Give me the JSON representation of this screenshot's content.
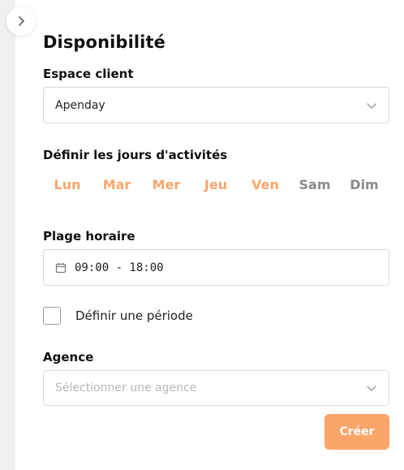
{
  "colors": {
    "accent": "#fba56b",
    "inactive_day": "#8a8a8a",
    "border": "#d9d9d9"
  },
  "header": {
    "collapse_icon": "chevron-right-icon",
    "title": "Disponibilité"
  },
  "client_space": {
    "label": "Espace client",
    "value": "Apenday",
    "icon": "chevron-down-icon"
  },
  "activity_days": {
    "label": "Définir les jours d'activités",
    "days": [
      {
        "label": "Lun",
        "active": true
      },
      {
        "label": "Mar",
        "active": true
      },
      {
        "label": "Mer",
        "active": true
      },
      {
        "label": "Jeu",
        "active": true
      },
      {
        "label": "Ven",
        "active": true
      },
      {
        "label": "Sam",
        "active": false
      },
      {
        "label": "Dim",
        "active": false
      }
    ]
  },
  "time_range": {
    "label": "Plage horaire",
    "icon": "calendar-icon",
    "value": "09:00 - 18:00"
  },
  "period": {
    "label": "Définir une période",
    "checked": false
  },
  "agency": {
    "label": "Agence",
    "placeholder": "Sélectionner une agence",
    "icon": "chevron-down-icon"
  },
  "actions": {
    "create_label": "Créer"
  }
}
